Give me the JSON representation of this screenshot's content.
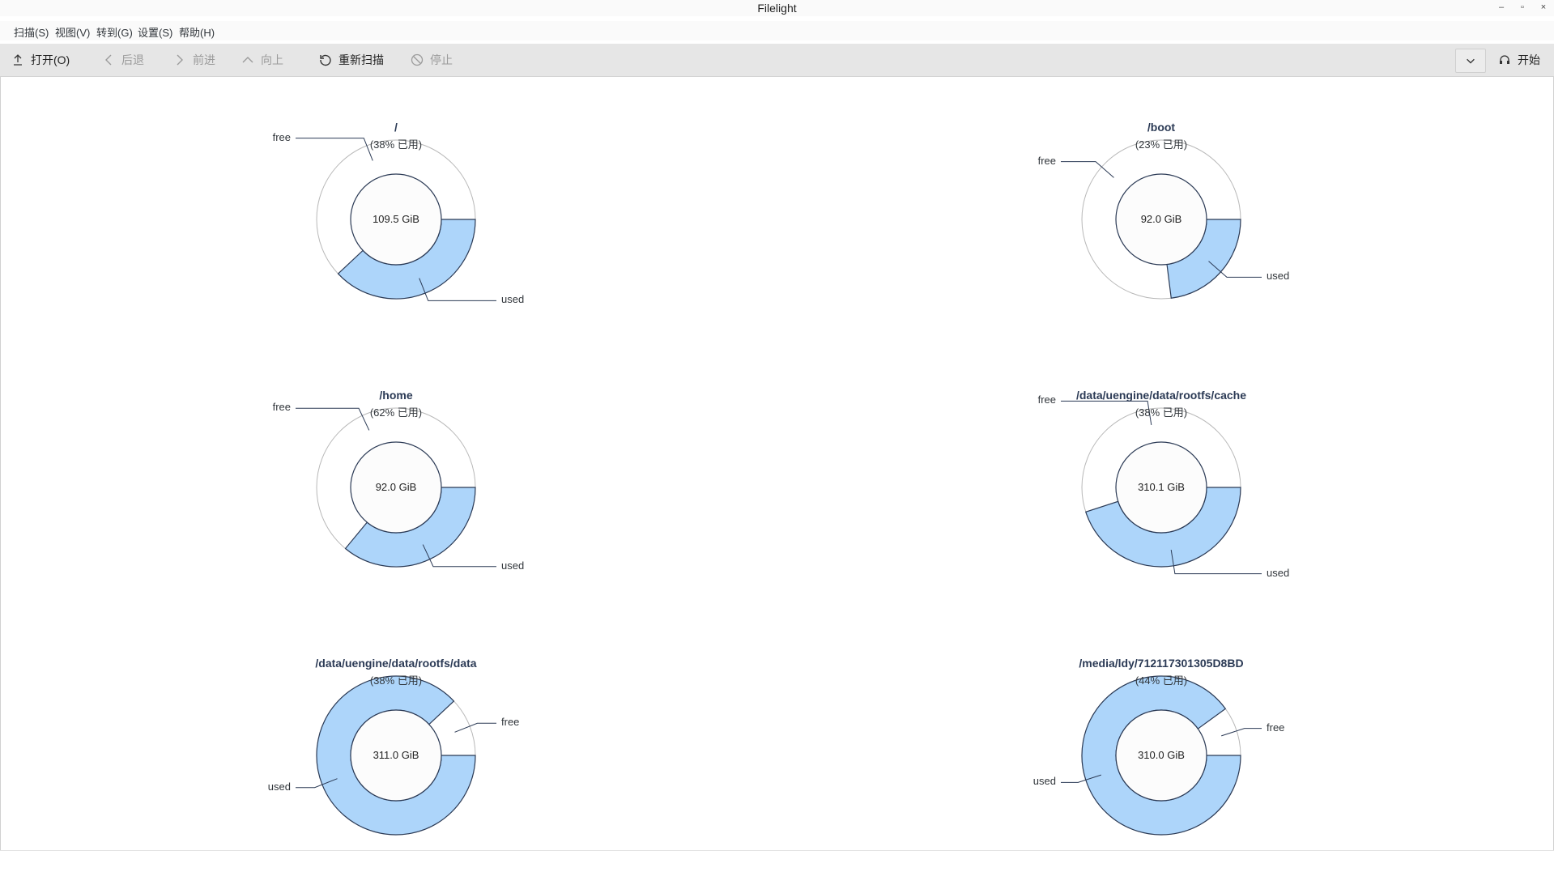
{
  "window": {
    "title": "Filelight",
    "minimize_icon": "minimize-icon",
    "maximize_icon": "maximize-icon",
    "close_icon": "close-icon"
  },
  "menu": [
    "扫描(S)",
    "视图(V)",
    "转到(G)",
    "设置(S)",
    "帮助(H)"
  ],
  "toolbar": {
    "open": "打开(O)",
    "back": "后退",
    "forward": "前进",
    "up": "向上",
    "rescan": "重新扫描",
    "stop": "停止",
    "start": "开始"
  },
  "colors": {
    "used_fill": "#add5fa",
    "free_fill": "#ffffff",
    "ring_stroke": "#2b3a55",
    "center_fill": "#fcfcfc"
  },
  "disks": [
    {
      "mount": "/",
      "usage": "(38% 已用)",
      "size": "109.5 GiB",
      "used_fraction": 0.38,
      "labels": {
        "free": "free",
        "used": "used"
      }
    },
    {
      "mount": "/boot",
      "usage": "(23% 已用)",
      "size": "92.0 GiB",
      "used_fraction": 0.23,
      "labels": {
        "free": "free",
        "used": "used"
      }
    },
    {
      "mount": "/home",
      "usage": "(62% 已用)",
      "size": "92.0 GiB",
      "used_fraction": 0.36,
      "labels": {
        "free": "free",
        "used": "used"
      }
    },
    {
      "mount": "/data/uengine/data/rootfs/cache",
      "usage": "(38% 已用)",
      "size": "310.1 GiB",
      "used_fraction": 0.45,
      "labels": {
        "free": "free",
        "used": "used"
      }
    },
    {
      "mount": "/data/uengine/data/rootfs/data",
      "usage": "(38% 已用)",
      "size": "311.0 GiB",
      "used_fraction": 0.88,
      "labels": {
        "free": "free",
        "used": "used"
      }
    },
    {
      "mount": "/media/ldy/712117301305D8BD",
      "usage": "(44% 已用)",
      "size": "310.0 GiB",
      "used_fraction": 0.9,
      "labels": {
        "free": "free",
        "used": "used"
      }
    }
  ]
}
